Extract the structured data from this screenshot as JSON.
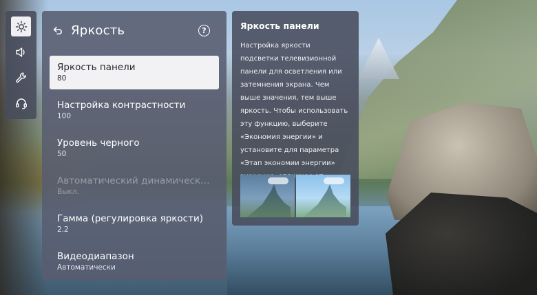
{
  "rail": {
    "items": [
      {
        "name": "picture",
        "icon": "picture-settings-icon",
        "active": true
      },
      {
        "name": "sound",
        "icon": "speaker-icon",
        "active": false
      },
      {
        "name": "general",
        "icon": "wrench-icon",
        "active": false
      },
      {
        "name": "support",
        "icon": "headset-icon",
        "active": false
      }
    ]
  },
  "menu": {
    "title": "Яркость",
    "back_icon": "back-arrow-icon",
    "help_icon": "help-icon",
    "help_glyph": "?",
    "items": [
      {
        "label": "Яркость панели",
        "value": "80",
        "state": "selected"
      },
      {
        "label": "Настройка контрастности",
        "value": "100",
        "state": "normal"
      },
      {
        "label": "Уровень черного",
        "value": "50",
        "state": "normal"
      },
      {
        "label": "Автоматический динамический ...",
        "value": "Выкл.",
        "state": "disabled"
      },
      {
        "label": "Гамма (регулировка яркости)",
        "value": "2.2",
        "state": "normal"
      },
      {
        "label": "Видеодиапазон",
        "value": "Автоматически",
        "state": "normal"
      }
    ]
  },
  "description": {
    "title": "Яркость панели",
    "text": "Настройка яркости подсветки телевизионной панели для осветления или затемнения экрана. Чем выше значения, тем выше яркость. Чтобы использовать эту функцию, выберите «Экономия энергии» и установите для параметра «Этап экономии энергии» значение, отличное от «Авто».",
    "preview_images": [
      "dim-landscape-preview",
      "bright-landscape-preview"
    ]
  },
  "colors": {
    "panel": "#585c70",
    "selected_bg": "#f2f2f4",
    "selected_text": "#2a2a33",
    "disabled_text": "#8e909c"
  }
}
